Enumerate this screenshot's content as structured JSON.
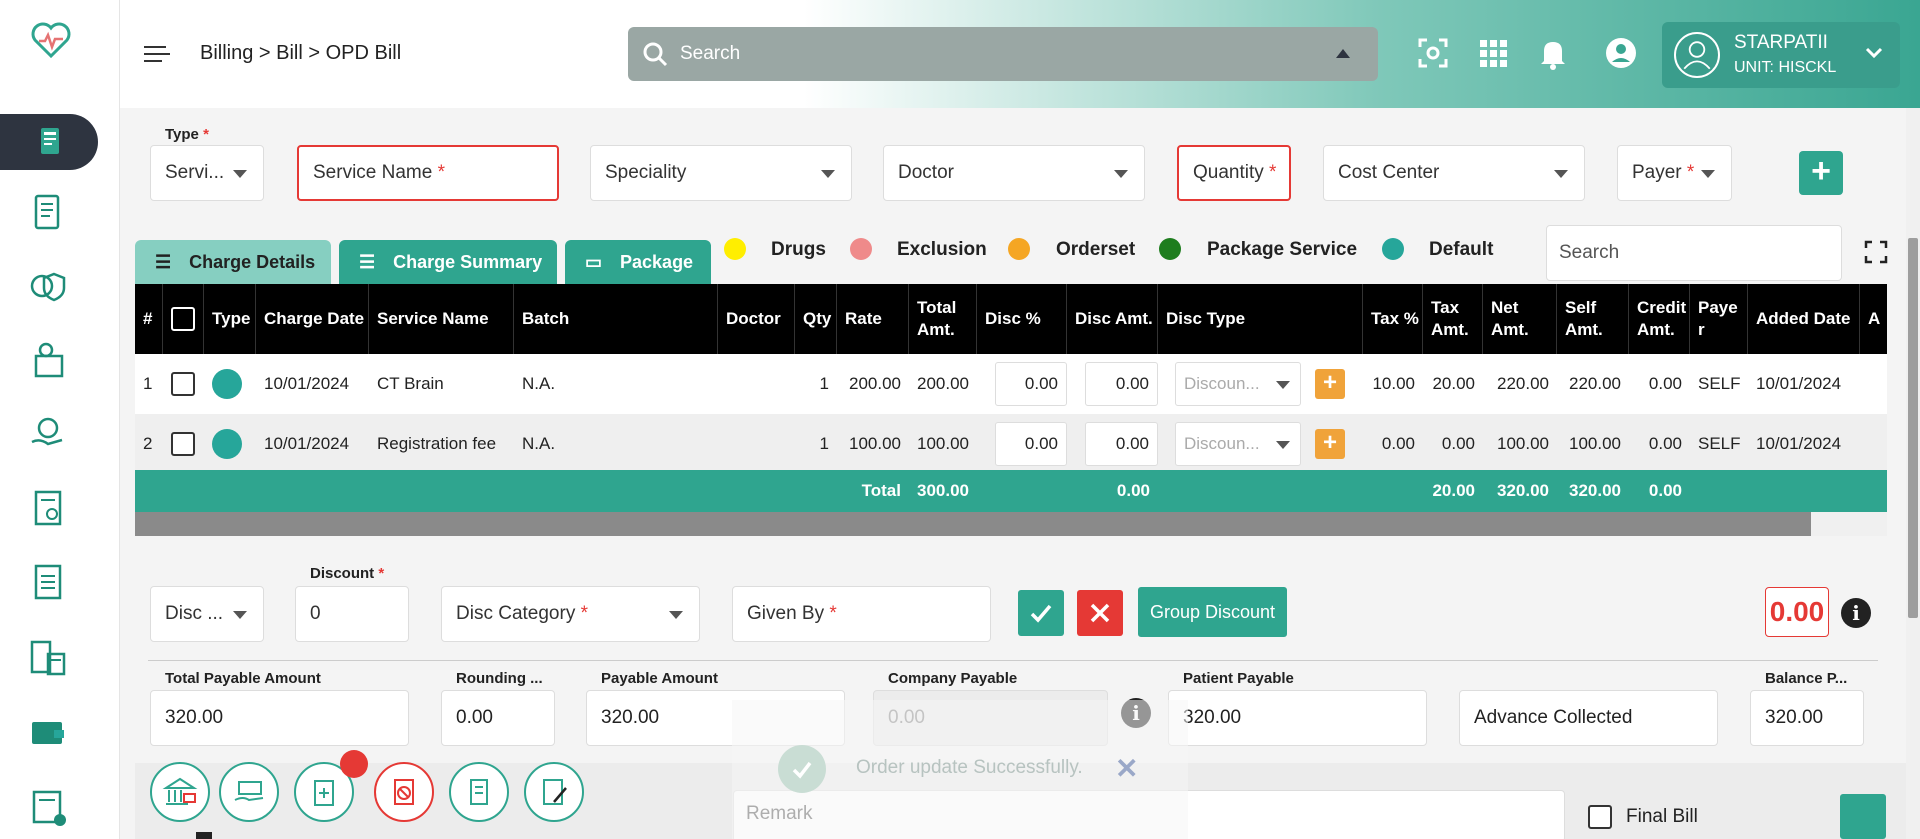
{
  "header": {
    "breadcrumb": "Billing > Bill > OPD Bill",
    "search_placeholder": "Search",
    "user_name": "STARPATII",
    "user_unit": "UNIT: HISCKL"
  },
  "sidebar": {
    "items": [
      {
        "icon": "billing-icon",
        "active": true
      },
      {
        "icon": "scroll-document-icon"
      },
      {
        "icon": "money-shield-icon"
      },
      {
        "icon": "hand-coin-icon"
      },
      {
        "icon": "hand-money-icon"
      },
      {
        "icon": "certificate-icon"
      },
      {
        "icon": "invoice-icon"
      },
      {
        "icon": "calculator-bill-icon"
      },
      {
        "icon": "wallet-icon"
      },
      {
        "icon": "bill-cancel-icon"
      }
    ]
  },
  "filters": {
    "type_label": "Type",
    "type_value": "Servi...",
    "service_name": "Service Name",
    "speciality": "Speciality",
    "doctor": "Doctor",
    "quantity": "Quantity",
    "cost_center": "Cost Center",
    "payer": "Payer"
  },
  "tabs": [
    {
      "label": "Charge Details"
    },
    {
      "label": "Charge Summary"
    },
    {
      "label": "Package"
    }
  ],
  "legend": [
    {
      "label": "Drugs",
      "color": "#ffee00"
    },
    {
      "label": "Exclusion",
      "color": "#ef8a8a"
    },
    {
      "label": "Orderset",
      "color": "#f5a623"
    },
    {
      "label": "Package Service",
      "color": "#1e7d1e"
    },
    {
      "label": "Default",
      "color": "#26a69a"
    }
  ],
  "table_search_placeholder": "Search",
  "table": {
    "headers": {
      "num": "#",
      "type": "Type",
      "charge_date": "Charge Date",
      "service_name": "Service Name",
      "batch": "Batch",
      "doctor": "Doctor",
      "qty": "Qty",
      "rate": "Rate",
      "total_amt": "Total Amt.",
      "disc_pct": "Disc %",
      "disc_amt": "Disc Amt.",
      "disc_type": "Disc Type",
      "tax_pct": "Tax %",
      "tax_amt": "Tax Amt.",
      "net_amt": "Net Amt.",
      "self_amt": "Self Amt.",
      "credit_amt": "Credit Amt.",
      "payer": "Paye r",
      "added_date": "Added Date",
      "extra": "A"
    },
    "rows": [
      {
        "num": "1",
        "charge_date": "10/01/2024",
        "service_name": "CT Brain",
        "batch": "N.A.",
        "doctor": "",
        "qty": "1",
        "rate": "200.00",
        "total_amt": "200.00",
        "disc_pct": "0.00",
        "disc_amt": "0.00",
        "disc_type": "Discoun...",
        "tax_pct": "10.00",
        "tax_amt": "20.00",
        "net_amt": "220.00",
        "self_amt": "220.00",
        "credit_amt": "0.00",
        "payer": "SELF",
        "added_date": "10/01/2024"
      },
      {
        "num": "2",
        "charge_date": "10/01/2024",
        "service_name": "Registration fee",
        "batch": "N.A.",
        "doctor": "",
        "qty": "1",
        "rate": "100.00",
        "total_amt": "100.00",
        "disc_pct": "0.00",
        "disc_amt": "0.00",
        "disc_type": "Discoun...",
        "tax_pct": "0.00",
        "tax_amt": "0.00",
        "net_amt": "100.00",
        "self_amt": "100.00",
        "credit_amt": "0.00",
        "payer": "SELF",
        "added_date": "10/01/2024"
      }
    ],
    "totals": {
      "label": "Total",
      "total_amt": "300.00",
      "disc_amt": "0.00",
      "tax_amt": "20.00",
      "net_amt": "320.00",
      "self_amt": "320.00",
      "credit_amt": "0.00"
    }
  },
  "discount": {
    "disc_select": "Disc ...",
    "discount_label": "Discount",
    "discount_value": "0",
    "disc_category": "Disc Category",
    "given_by": "Given By",
    "group_discount": "Group Discount",
    "amount": "0.00"
  },
  "payable": {
    "total_payable_label": "Total Payable Amount",
    "total_payable": "320.00",
    "rounding_label": "Rounding ...",
    "rounding": "0.00",
    "payable_label": "Payable Amount",
    "payable": "320.00",
    "company_payable_label": "Company Payable",
    "company_payable": "0.00",
    "patient_payable_label": "Patient Payable",
    "patient_payable": "320.00",
    "advance_collected": "Advance Collected",
    "balance_label": "Balance P...",
    "balance": "320.00"
  },
  "bottom": {
    "remark_placeholder": "Remark",
    "final_bill": "Final Bill"
  },
  "toast": {
    "message": "Order update Successfully."
  }
}
